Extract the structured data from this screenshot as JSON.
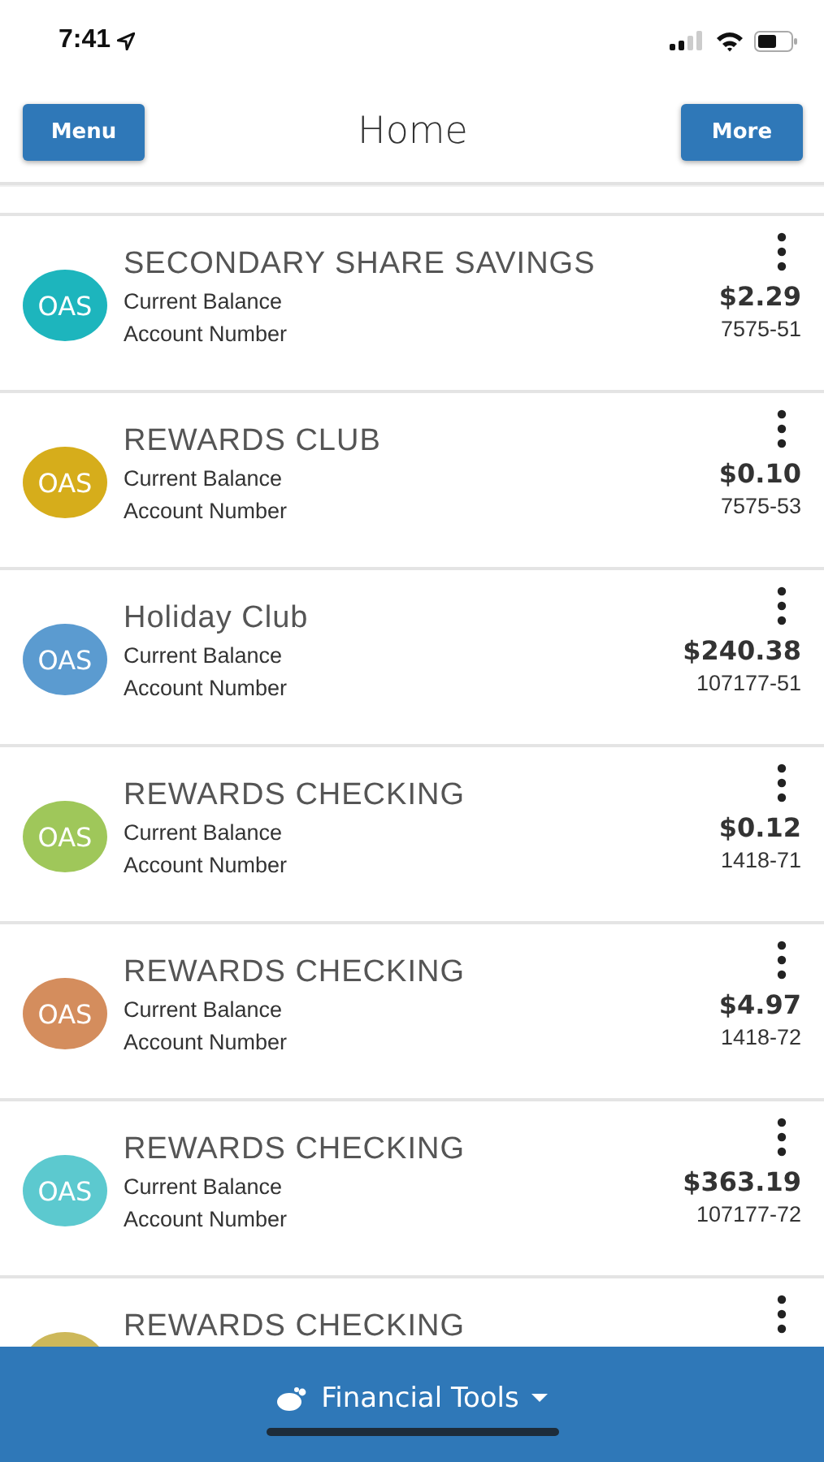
{
  "status_bar": {
    "time": "7:41"
  },
  "header": {
    "title": "Home",
    "left_button": "Menu",
    "right_button": "More"
  },
  "accounts": [
    {
      "kind": "full",
      "name": "SECONDARY SHARE SAVINGS",
      "initials": "OAS",
      "color": "#1db5bd",
      "balance_label": "Current Balance",
      "number_label": "Account Number",
      "balance": "$2.29",
      "number": "7575-51"
    },
    {
      "kind": "full",
      "name": "REWARDS CLUB",
      "initials": "OAS",
      "color": "#d6ad1b",
      "balance_label": "Current Balance",
      "number_label": "Account Number",
      "balance": "$0.10",
      "number": "7575-53"
    },
    {
      "kind": "full",
      "name": "Holiday Club",
      "initials": "OAS",
      "color": "#5b9bd0",
      "balance_label": "Current Balance",
      "number_label": "Account Number",
      "balance": "$240.38",
      "number": "107177-51"
    },
    {
      "kind": "full",
      "name": "REWARDS CHECKING",
      "initials": "OAS",
      "color": "#9fc75a",
      "balance_label": "Current Balance",
      "number_label": "Account Number",
      "balance": "$0.12",
      "number": "1418-71"
    },
    {
      "kind": "full",
      "name": "REWARDS CHECKING",
      "initials": "OAS",
      "color": "#d48d5d",
      "balance_label": "Current Balance",
      "number_label": "Account Number",
      "balance": "$4.97",
      "number": "1418-72"
    },
    {
      "kind": "full",
      "name": "REWARDS CHECKING",
      "initials": "OAS",
      "color": "#5cc9cf",
      "balance_label": "Current Balance",
      "number_label": "Account Number",
      "balance": "$363.19",
      "number": "107177-72"
    },
    {
      "kind": "cut",
      "name": "REWARDS CHECKING",
      "color": "#cdb85a"
    }
  ],
  "bottom_bar": {
    "label": "Financial Tools"
  }
}
